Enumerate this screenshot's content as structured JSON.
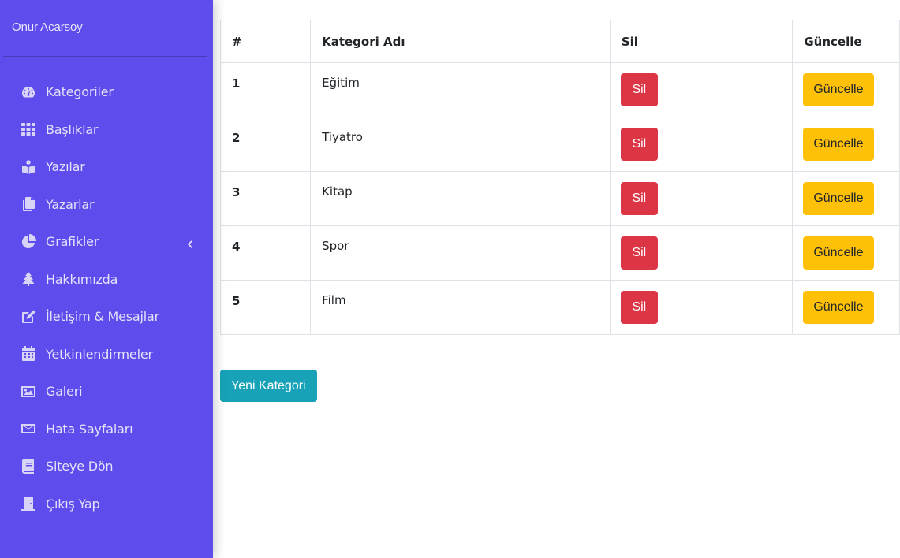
{
  "sidebar": {
    "user_name": "Onur Acarsoy",
    "items": [
      {
        "label": "Kategoriler",
        "icon": "tachometer-icon"
      },
      {
        "label": "Başlıklar",
        "icon": "grid-icon"
      },
      {
        "label": "Yazılar",
        "icon": "reader-icon"
      },
      {
        "label": "Yazarlar",
        "icon": "copy-icon"
      },
      {
        "label": "Grafikler",
        "icon": "pie-chart-icon"
      },
      {
        "label": "Hakkımızda",
        "icon": "tree-icon"
      },
      {
        "label": "İletişim & Mesajlar",
        "icon": "edit-icon"
      },
      {
        "label": "Yetkinlendirmeler",
        "icon": "calendar-icon"
      },
      {
        "label": "Galeri",
        "icon": "image-icon"
      },
      {
        "label": "Hata Sayfaları",
        "icon": "envelope-icon"
      },
      {
        "label": "Siteye Dön",
        "icon": "book-icon"
      },
      {
        "label": "Çıkış Yap",
        "icon": "door-icon"
      }
    ]
  },
  "table": {
    "headers": [
      "#",
      "Kategori Adı",
      "Sil",
      "Güncelle"
    ],
    "rows": [
      {
        "id": "1",
        "name": "Eğitim",
        "delete": "Sil",
        "update": "Güncelle"
      },
      {
        "id": "2",
        "name": "Tiyatro",
        "delete": "Sil",
        "update": "Güncelle"
      },
      {
        "id": "3",
        "name": "Kitap",
        "delete": "Sil",
        "update": "Güncelle"
      },
      {
        "id": "4",
        "name": "Spor",
        "delete": "Sil",
        "update": "Güncelle"
      },
      {
        "id": "5",
        "name": "Film",
        "delete": "Sil",
        "update": "Güncelle"
      }
    ]
  },
  "new_category_button": "Yeni Kategori",
  "colors": {
    "sidebar": "#5f4cec",
    "danger": "#dc3545",
    "warning": "#ffc107",
    "info": "#17a2b8"
  }
}
